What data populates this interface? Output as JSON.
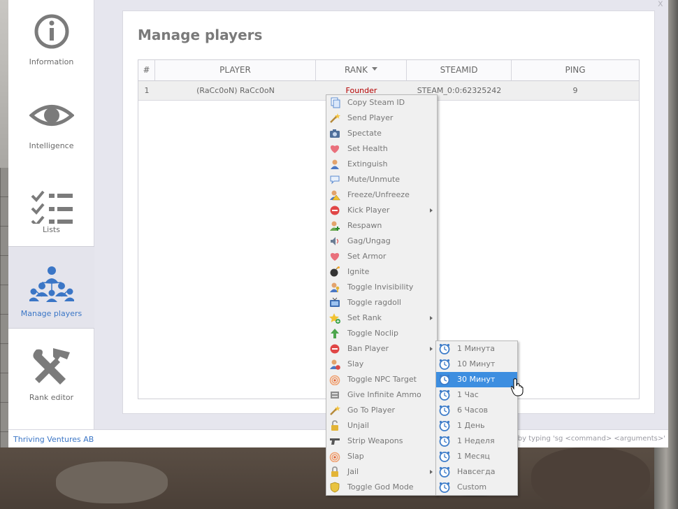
{
  "window": {
    "close_label": "x"
  },
  "sidebar": {
    "items": [
      {
        "label": "Information",
        "icon": "info-icon",
        "active": false
      },
      {
        "label": "Intelligence",
        "icon": "eye-icon",
        "active": false
      },
      {
        "label": "Lists",
        "icon": "checklist-icon",
        "active": false
      },
      {
        "label": "Manage players",
        "icon": "people-network-icon",
        "active": true
      },
      {
        "label": "Rank editor",
        "icon": "tools-icon",
        "active": false
      }
    ]
  },
  "main": {
    "title": "Manage players",
    "table": {
      "columns": [
        "#",
        "PLAYER",
        "RANK",
        "STEAMID",
        "PING"
      ],
      "sorted_by": "RANK",
      "rows": [
        {
          "num": "1",
          "player": "(RaCc0oN) RaCc0oN",
          "rank": "Founder",
          "steamid": "STEAM_0:0:62325242",
          "ping": "9"
        }
      ]
    }
  },
  "context_menu": {
    "items": [
      {
        "label": "Copy Steam ID",
        "icon": "copy-icon"
      },
      {
        "label": "Send Player",
        "icon": "wand-icon"
      },
      {
        "label": "Spectate",
        "icon": "camera-icon"
      },
      {
        "label": "Set Health",
        "icon": "heart-icon"
      },
      {
        "label": "Extinguish",
        "icon": "user-icon"
      },
      {
        "label": "Mute/Unmute",
        "icon": "speech-bubble-icon"
      },
      {
        "label": "Freeze/Unfreeze",
        "icon": "warning-user-icon"
      },
      {
        "label": "Kick Player",
        "icon": "stop-icon",
        "submenu": true
      },
      {
        "label": "Respawn",
        "icon": "user-add-icon"
      },
      {
        "label": "Gag/Ungag",
        "icon": "speaker-icon"
      },
      {
        "label": "Set Armor",
        "icon": "heart-icon"
      },
      {
        "label": "Ignite",
        "icon": "bomb-icon"
      },
      {
        "label": "Toggle Invisibility",
        "icon": "user-key-icon"
      },
      {
        "label": "Toggle ragdoll",
        "icon": "tv-icon"
      },
      {
        "label": "Set Rank",
        "icon": "star-add-icon",
        "submenu": true
      },
      {
        "label": "Toggle Noclip",
        "icon": "arrow-up-icon"
      },
      {
        "label": "Ban Player",
        "icon": "stop-icon",
        "submenu": true
      },
      {
        "label": "Slay",
        "icon": "user-delete-icon"
      },
      {
        "label": "Toggle NPC Target",
        "icon": "rss-icon"
      },
      {
        "label": "Give Infinite Ammo",
        "icon": "ammo-icon"
      },
      {
        "label": "Go To Player",
        "icon": "wand-icon"
      },
      {
        "label": "Unjail",
        "icon": "unlock-icon"
      },
      {
        "label": "Strip Weapons",
        "icon": "gun-icon"
      },
      {
        "label": "Slap",
        "icon": "rss-icon"
      },
      {
        "label": "Jail",
        "icon": "lock-icon",
        "submenu": true
      },
      {
        "label": "Toggle God Mode",
        "icon": "shield-icon"
      }
    ]
  },
  "ban_submenu": {
    "items": [
      {
        "label": "1 Минута"
      },
      {
        "label": "10 Минут"
      },
      {
        "label": "30 Минут",
        "highlighted": true
      },
      {
        "label": "1 Час"
      },
      {
        "label": "6 Часов"
      },
      {
        "label": "1 День"
      },
      {
        "label": "1 Неделя"
      },
      {
        "label": "1 Месяц"
      },
      {
        "label": "Навсегда"
      },
      {
        "label": "Custom"
      }
    ]
  },
  "footer": {
    "company": "Thriving Ventures AB",
    "console_hint": "sole by typing 'sg <command> <arguments>'"
  },
  "colors": {
    "accent": "#3b76c6",
    "rank_founder": "#b40000",
    "highlight": "#3d8ee0"
  }
}
